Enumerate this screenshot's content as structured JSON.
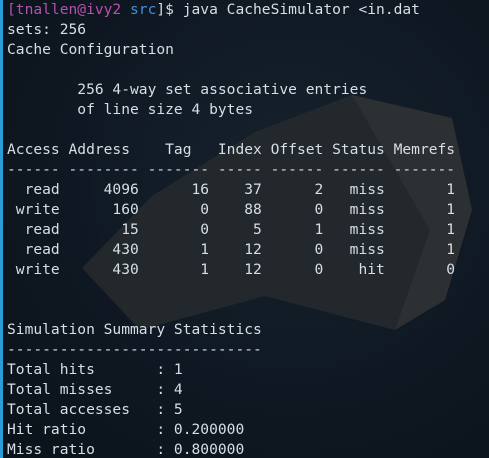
{
  "theme": {
    "background": "#0d1620",
    "foreground": "#d6dee6",
    "prompt_user_color": "#b451b0",
    "prompt_dir_color": "#3f8fd8",
    "accent_bar": "#2a9dd8"
  },
  "prompt": {
    "user_host": "[tnallen@ivy2 ",
    "dir": "src",
    "suffix": "]$ ",
    "command": "java CacheSimulator <in.dat"
  },
  "output": {
    "sets_line": "sets: 256",
    "config_title": "Cache Configuration",
    "config_line1": "        256 4-way set associative entries",
    "config_line2": "        of line size 4 bytes",
    "table": {
      "header": "Access Address    Tag   Index Offset Status Memrefs",
      "separator": "------ -------- ------- ----- ------ ------ -------",
      "rows": [
        "  read     4096      16    37      2   miss       1",
        " write      160       0    88      0   miss       1",
        "  read       15       0     5      1   miss       1",
        "  read      430       1    12      0   miss       1",
        " write      430       1    12      0    hit       0"
      ]
    },
    "summary_title": "Simulation Summary Statistics",
    "summary_separator": "-----------------------------",
    "stats": [
      "Total hits       : 1",
      "Total misses     : 4",
      "Total accesses   : 5",
      "Hit ratio        : 0.200000",
      "Miss ratio       : 0.800000"
    ]
  }
}
